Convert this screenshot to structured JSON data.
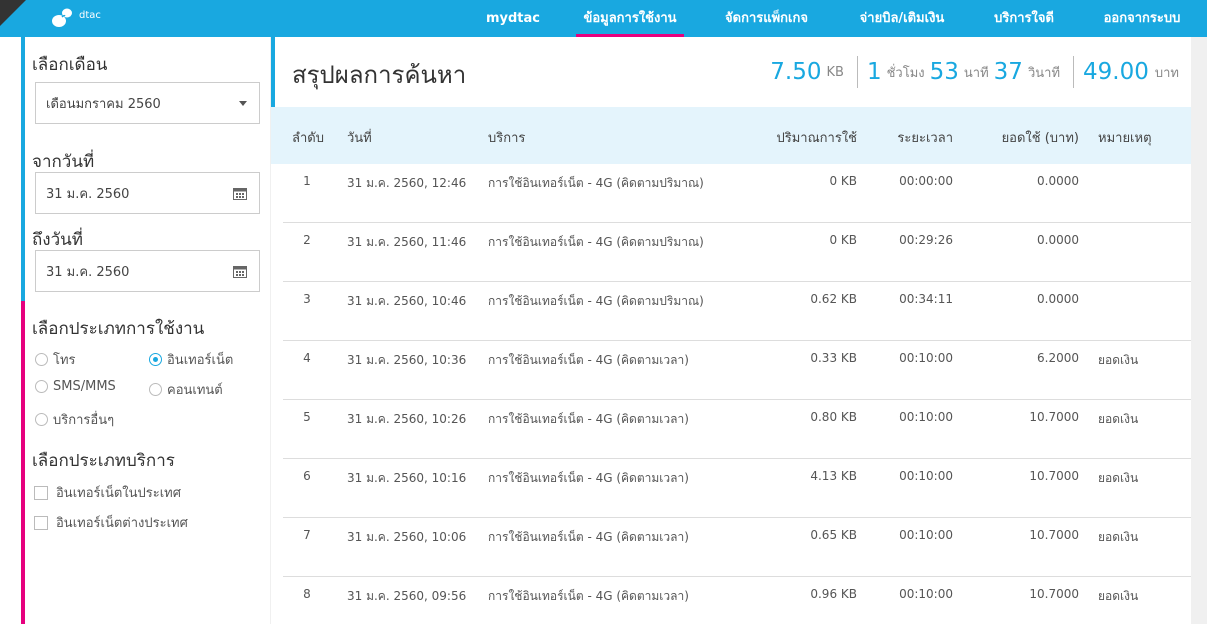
{
  "brand": {
    "logo_text": "dtac",
    "colors": {
      "primary": "#19a8e0",
      "accent": "#e6007e"
    }
  },
  "nav": {
    "items": [
      {
        "label": "mydtac"
      },
      {
        "label": "ข้อมูลการใช้งาน"
      },
      {
        "label": "จัดการแพ็กเกจ"
      },
      {
        "label": "จ่ายบิล/เติมเงิน"
      },
      {
        "label": "บริการใจดี"
      },
      {
        "label": "ออกจากระบบ"
      }
    ],
    "active_item": "ข้อมูลการใช้งาน"
  },
  "sidebar": {
    "month_label": "เลือกเดือน",
    "month_value": "เดือนมกราคม 2560",
    "from_label": "จากวันที่",
    "from_value": "31 ม.ค. 2560",
    "to_label": "ถึงวันที่",
    "to_value": "31 ม.ค. 2560",
    "usage_type_label": "เลือกประเภทการใช้งาน",
    "usage_types": [
      {
        "label": "โทร",
        "selected": false
      },
      {
        "label": "อินเทอร์เน็ต",
        "selected": true
      },
      {
        "label": "SMS/MMS",
        "selected": false
      },
      {
        "label": "คอนเทนต์",
        "selected": false
      },
      {
        "label": "บริการอื่นๆ",
        "selected": false
      }
    ],
    "service_type_label": "เลือกประเภทบริการ",
    "service_types": [
      {
        "label": "อินเทอร์เน็ตในประเทศ",
        "checked": false
      },
      {
        "label": "อินเทอร์เน็ตต่างประเทศ",
        "checked": false
      }
    ]
  },
  "main": {
    "title": "สรุปผลการค้นหา",
    "summary": {
      "data_value": "7.50",
      "data_unit": "KB",
      "hours": "1",
      "hours_unit": "ชั่วโมง",
      "minutes": "53",
      "minutes_unit": "นาที",
      "seconds": "37",
      "seconds_unit": "วินาที",
      "cost": "49.00",
      "cost_unit": "บาท"
    },
    "table": {
      "headers": [
        "ลำดับ",
        "วันที่",
        "บริการ",
        "ปริมาณการใช้",
        "ระยะเวลา",
        "ยอดใช้ (บาท)",
        "หมายเหตุ"
      ],
      "rows": [
        [
          "1",
          "31 ม.ค. 2560, 12:46",
          "การใช้อินเทอร์เน็ต - 4G (คิดตามปริมาณ)",
          "0 KB",
          "00:00:00",
          "0.0000",
          ""
        ],
        [
          "2",
          "31 ม.ค. 2560, 11:46",
          "การใช้อินเทอร์เน็ต - 4G (คิดตามปริมาณ)",
          "0 KB",
          "00:29:26",
          "0.0000",
          ""
        ],
        [
          "3",
          "31 ม.ค. 2560, 10:46",
          "การใช้อินเทอร์เน็ต - 4G (คิดตามปริมาณ)",
          "0.62 KB",
          "00:34:11",
          "0.0000",
          ""
        ],
        [
          "4",
          "31 ม.ค. 2560, 10:36",
          "การใช้อินเทอร์เน็ต - 4G (คิดตามเวลา)",
          "0.33 KB",
          "00:10:00",
          "6.2000",
          "ยอดเงิน"
        ],
        [
          "5",
          "31 ม.ค. 2560, 10:26",
          "การใช้อินเทอร์เน็ต - 4G (คิดตามเวลา)",
          "0.80 KB",
          "00:10:00",
          "10.7000",
          "ยอดเงิน"
        ],
        [
          "6",
          "31 ม.ค. 2560, 10:16",
          "การใช้อินเทอร์เน็ต - 4G (คิดตามเวลา)",
          "4.13 KB",
          "00:10:00",
          "10.7000",
          "ยอดเงิน"
        ],
        [
          "7",
          "31 ม.ค. 2560, 10:06",
          "การใช้อินเทอร์เน็ต - 4G (คิดตามเวลา)",
          "0.65 KB",
          "00:10:00",
          "10.7000",
          "ยอดเงิน"
        ],
        [
          "8",
          "31 ม.ค. 2560, 09:56",
          "การใช้อินเทอร์เน็ต - 4G (คิดตามเวลา)",
          "0.96 KB",
          "00:10:00",
          "10.7000",
          "ยอดเงิน"
        ]
      ]
    }
  }
}
